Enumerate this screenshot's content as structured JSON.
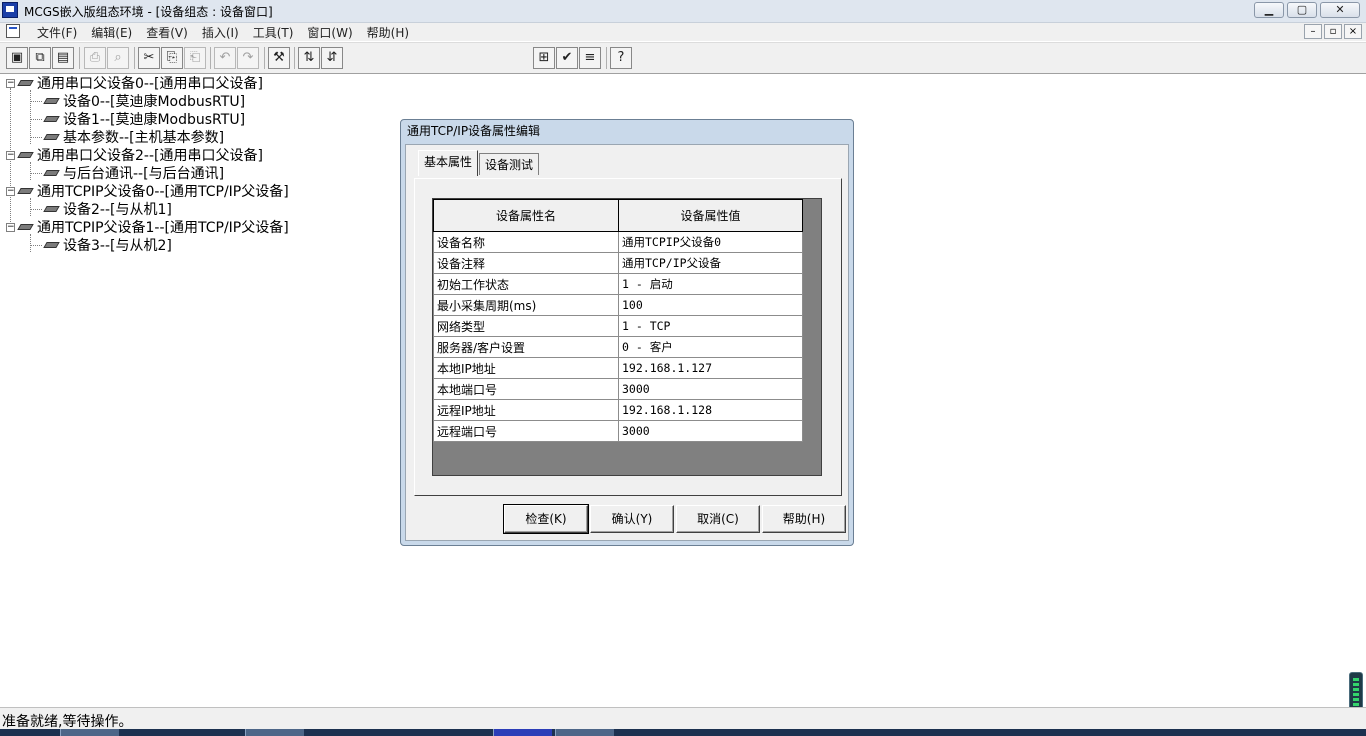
{
  "window": {
    "title": "MCGS嵌入版组态环境 - [设备组态 : 设备窗口]",
    "minimize": "▁",
    "maximize": "▢",
    "close": "✕"
  },
  "menu": {
    "items": [
      "文件(F)",
      "编辑(E)",
      "查看(V)",
      "插入(I)",
      "工具(T)",
      "窗口(W)",
      "帮助(H)"
    ],
    "mdi_minimize": "–",
    "mdi_restore": "▫",
    "mdi_close": "×"
  },
  "toolbar": {
    "icons": [
      "▣",
      "⧉",
      "▤",
      "⎙",
      "⌕",
      "✂",
      "⎘",
      "⎗",
      "↶",
      "↷",
      "⚒",
      "⇅",
      "⇵",
      "⊞",
      "✔",
      "≡",
      "?"
    ]
  },
  "tree": {
    "nodes": [
      {
        "label": "通用串口父设备0--[通用串口父设备]",
        "level": 0,
        "expander": "−"
      },
      {
        "label": "设备0--[莫迪康ModbusRTU]",
        "level": 1
      },
      {
        "label": "设备1--[莫迪康ModbusRTU]",
        "level": 1
      },
      {
        "label": "基本参数--[主机基本参数]",
        "level": 1
      },
      {
        "label": "通用串口父设备2--[通用串口父设备]",
        "level": 0,
        "expander": "−"
      },
      {
        "label": "与后台通讯--[与后台通讯]",
        "level": 1
      },
      {
        "label": "通用TCPIP父设备0--[通用TCP/IP父设备]",
        "level": 0,
        "expander": "−"
      },
      {
        "label": "设备2--[与从机1]",
        "level": 1
      },
      {
        "label": "通用TCPIP父设备1--[通用TCP/IP父设备]",
        "level": 0,
        "expander": "−"
      },
      {
        "label": "设备3--[与从机2]",
        "level": 1
      }
    ]
  },
  "status": {
    "text": "准备就绪,等待操作。"
  },
  "dialog": {
    "title": "通用TCP/IP设备属性编辑",
    "tabs": [
      "基本属性",
      "设备测试"
    ],
    "active_tab": 0,
    "columns": [
      "设备属性名",
      "设备属性值"
    ],
    "rows": [
      [
        "设备名称",
        "通用TCPIP父设备0"
      ],
      [
        "设备注释",
        "通用TCP/IP父设备"
      ],
      [
        "初始工作状态",
        "1 - 启动"
      ],
      [
        "最小采集周期(ms)",
        "100"
      ],
      [
        "网络类型",
        "1 - TCP"
      ],
      [
        "服务器/客户设置",
        "0 - 客户"
      ],
      [
        "本地IP地址",
        "192.168.1.127"
      ],
      [
        "本地端口号",
        "3000"
      ],
      [
        "远程IP地址",
        "192.168.1.128"
      ],
      [
        "远程端口号",
        "3000"
      ]
    ],
    "buttons": {
      "check": "检查(K)",
      "confirm": "确认(Y)",
      "cancel": "取消(C)",
      "help": "帮助(H)"
    }
  },
  "colors": {
    "dialog_frame": "#c9d9ea",
    "titlebar": "#dfe6ef",
    "grid_bg": "#808080",
    "indicator": "#34d36b"
  }
}
